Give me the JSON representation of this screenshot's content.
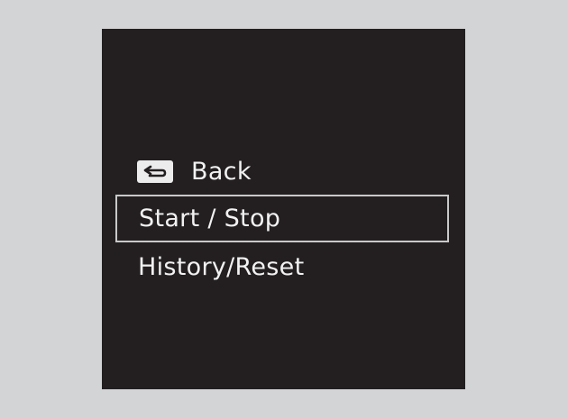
{
  "menu": {
    "items": [
      {
        "id": "back",
        "label": "Back",
        "icon": "back-arrow-icon"
      },
      {
        "id": "start-stop",
        "label": "Start / Stop",
        "selected": true
      },
      {
        "id": "history-reset",
        "label": "History/Reset"
      }
    ]
  },
  "colors": {
    "background": "#d3d4d6",
    "screen": "#231f20",
    "text": "#f2f2f2",
    "selection_border": "#c9c9c9",
    "icon_fill": "#ececec"
  }
}
